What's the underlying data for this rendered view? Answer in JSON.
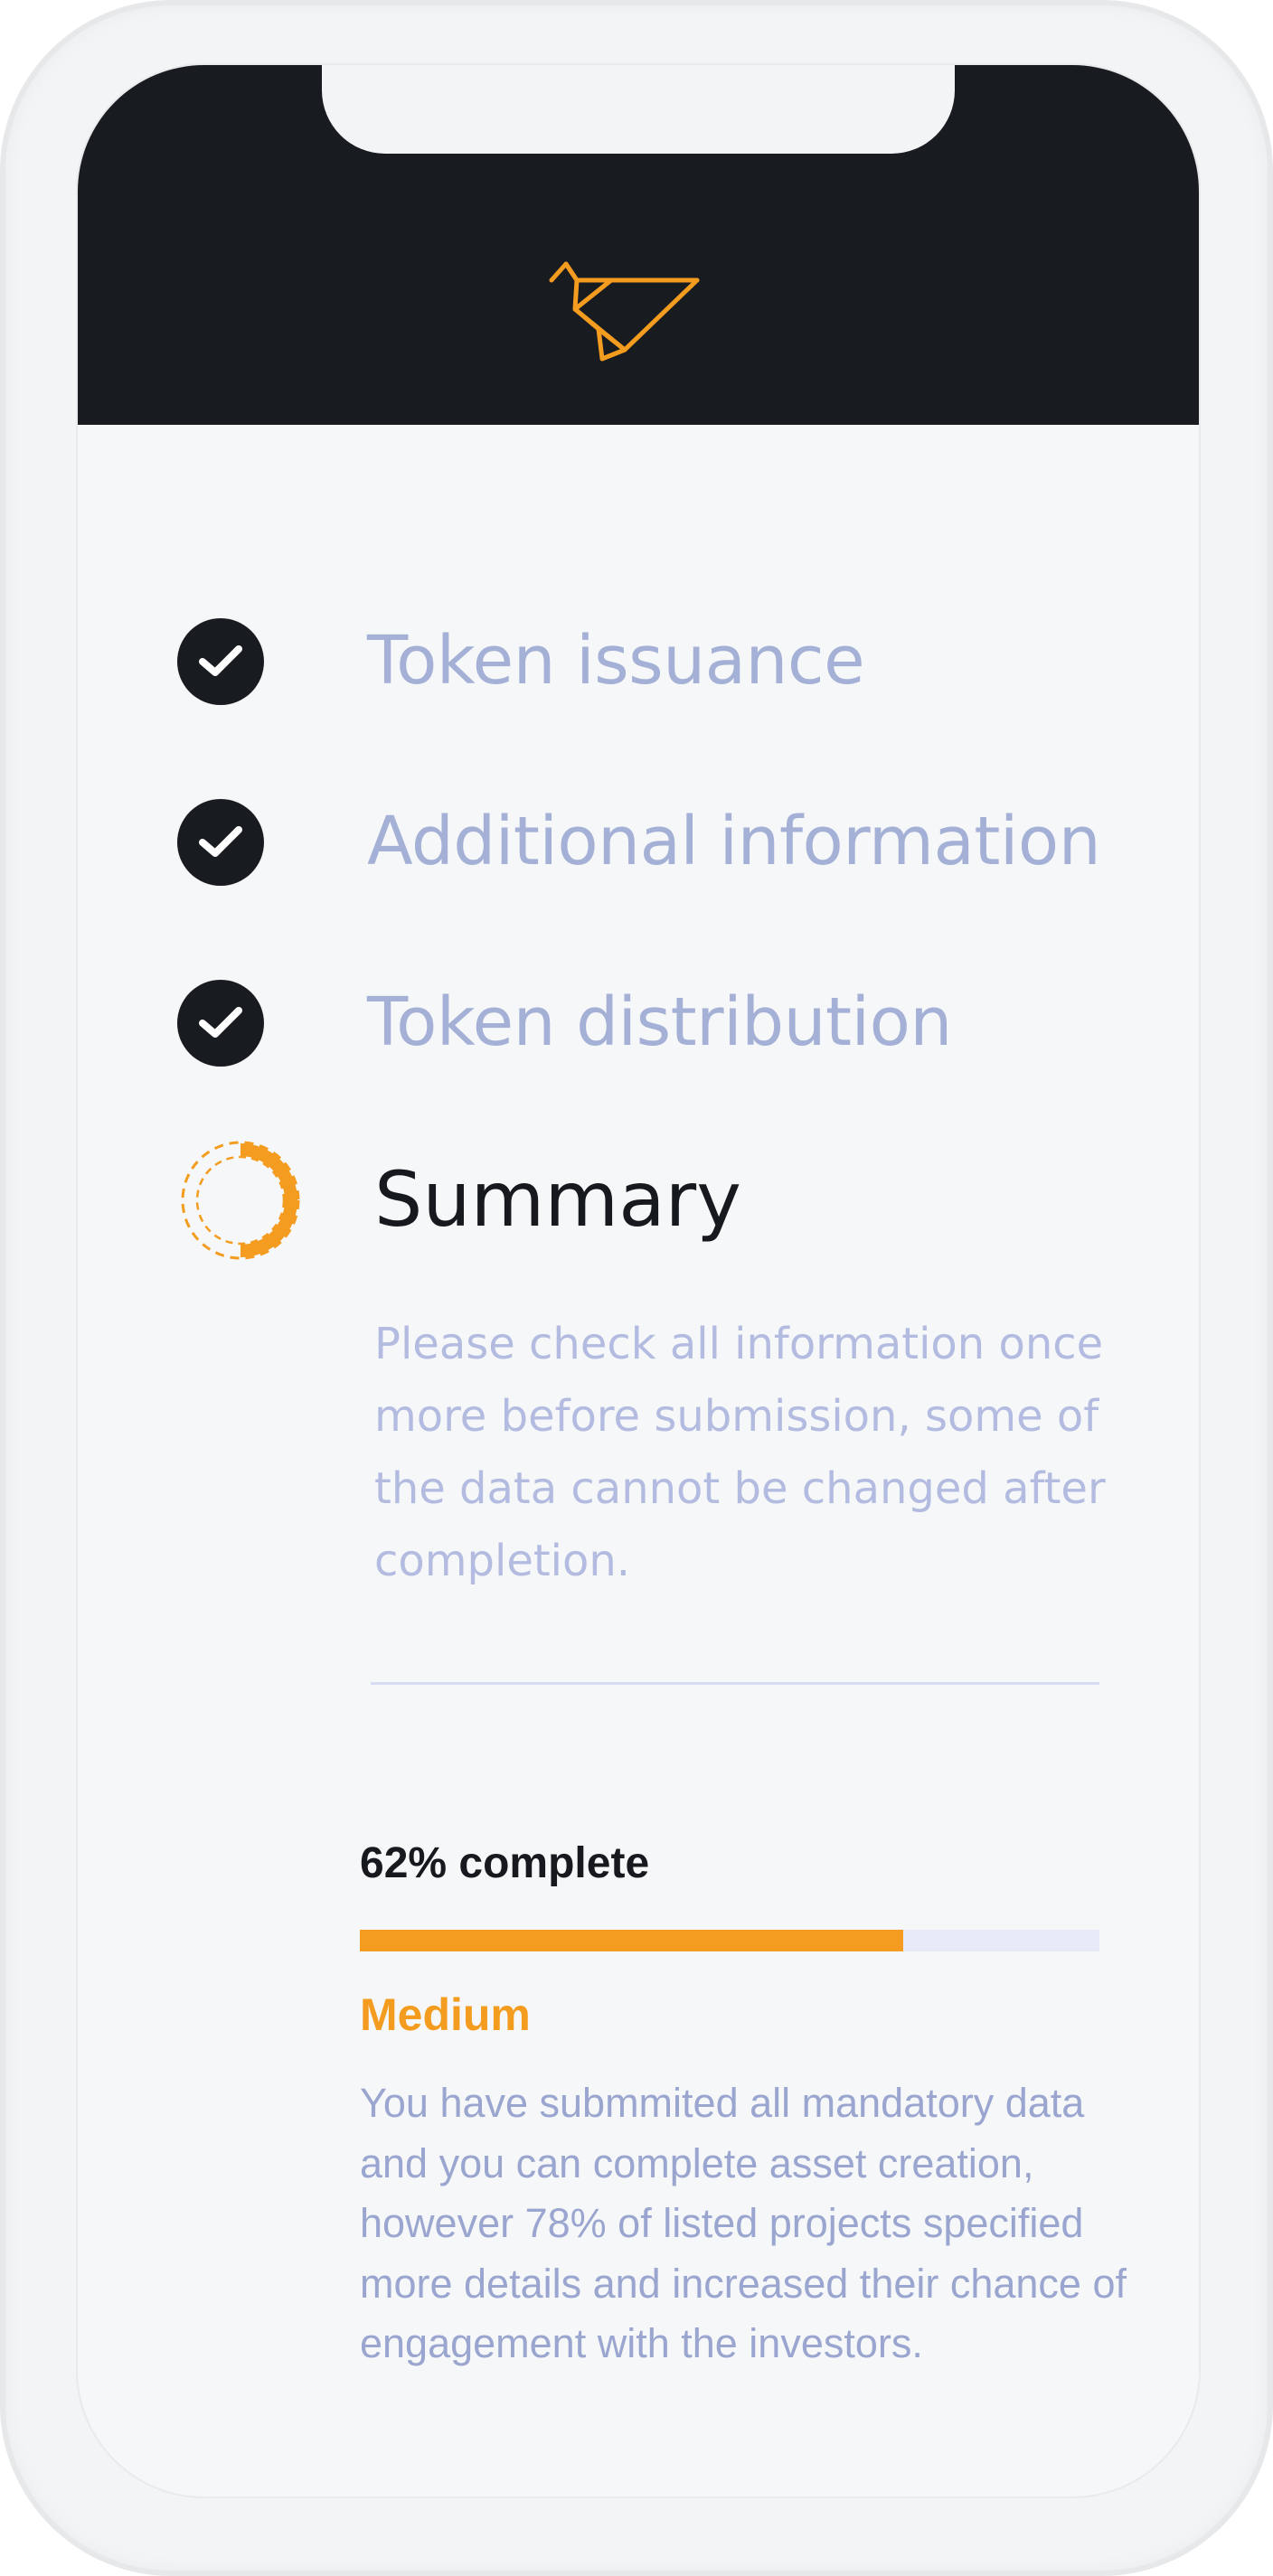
{
  "header": {
    "logo_icon": "origami-bird-icon",
    "accent_color": "#f39c1f",
    "background_color": "#181b1f"
  },
  "steps": [
    {
      "label": "Token issuance",
      "status": "completed",
      "icon": "check-icon"
    },
    {
      "label": "Additional information",
      "status": "completed",
      "icon": "check-icon"
    },
    {
      "label": "Token distribution",
      "status": "completed",
      "icon": "check-icon"
    }
  ],
  "summary": {
    "title": "Summary",
    "icon": "in-progress-ring-icon",
    "description": "Please check all information once more before submission, some of the data cannot be changed after completion."
  },
  "completion": {
    "label": "62% complete",
    "progress_fraction": 0.735,
    "level": "Medium",
    "level_color": "#f39c1f",
    "message": "You have submmited all mandatory data and you can complete asset creation, however 78% of listed projects specified more details and increased their chance of engagement with the investors."
  }
}
